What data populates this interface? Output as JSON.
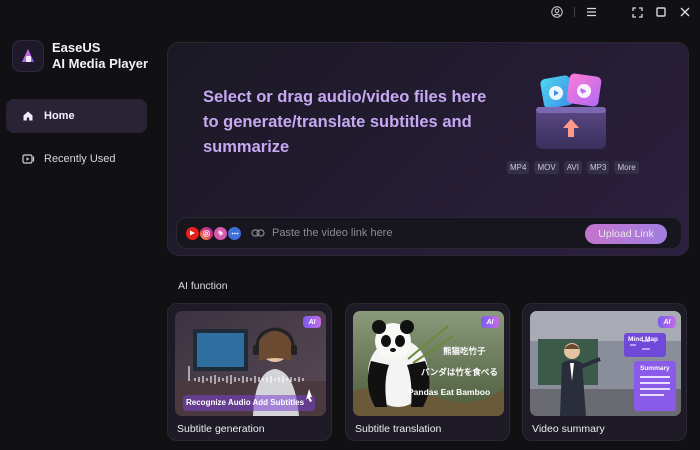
{
  "app": {
    "name_line1": "EaseUS",
    "name_line2": "AI Media Player"
  },
  "titlebar": {
    "icons": [
      "account-icon",
      "menu-icon",
      "fullscreen-icon",
      "maximize-icon",
      "close-icon"
    ]
  },
  "sidebar": {
    "items": [
      {
        "label": "Home",
        "icon": "home-icon",
        "active": true
      },
      {
        "label": "Recently Used",
        "icon": "recent-icon",
        "active": false
      }
    ]
  },
  "dropzone": {
    "line1": "Select or drag audio/video files here",
    "line2": "to generate/translate subtitles and",
    "line3": "summarize",
    "formats": [
      "MP4",
      "MOV",
      "AVI",
      "MP3",
      "More"
    ]
  },
  "linkbar": {
    "platforms": [
      "youtube-icon",
      "instagram-icon",
      "vimeo-icon",
      "more-platforms-icon"
    ],
    "placeholder": "Paste the video link here",
    "button": "Upload Link"
  },
  "ai_section": {
    "title": "AI function",
    "badge": "AI",
    "cards": [
      {
        "label": "Subtitle generation",
        "overlay": "Recognize Audio Add Subtitles"
      },
      {
        "label": "Subtitle translation",
        "overlay_zh": "熊猫吃竹子",
        "overlay_ja": "パンダは竹を食べる",
        "overlay_en": "Pandas Eat Bamboo"
      },
      {
        "label": "Video summary",
        "overlay_mindmap": "Mind Map",
        "overlay_summary": "Summary"
      }
    ]
  },
  "colors": {
    "accent": "#c6a9f2",
    "button_gradient_start": "#d77fe0",
    "button_gradient_end": "#b18af5"
  }
}
